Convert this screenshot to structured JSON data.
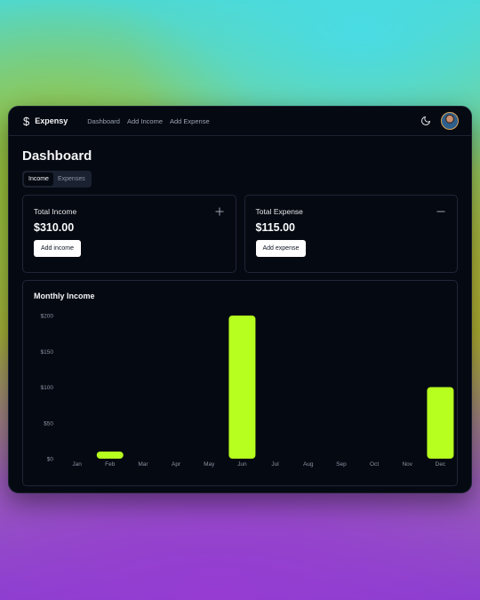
{
  "app": {
    "name": "Expensy",
    "logo_icon": "dollar-icon"
  },
  "nav": {
    "links": [
      "Dashboard",
      "Add Income",
      "Add Expense"
    ],
    "theme_icon": "moon-icon",
    "avatar_icon": "user-avatar"
  },
  "page": {
    "title": "Dashboard",
    "tabs": [
      {
        "label": "Income",
        "active": true
      },
      {
        "label": "Expenses",
        "active": false
      }
    ]
  },
  "cards": {
    "income": {
      "title": "Total Income",
      "value": "$310.00",
      "button": "Add income",
      "icon": "plus-icon"
    },
    "expense": {
      "title": "Total Expense",
      "value": "$115.00",
      "button": "Add expense",
      "icon": "minus-icon"
    }
  },
  "colors": {
    "accent": "#b6ff1f",
    "background": "#050911",
    "border": "#1f2636"
  },
  "chart_data": {
    "type": "bar",
    "title": "Monthly Income",
    "categories": [
      "Jan",
      "Feb",
      "Mar",
      "Apr",
      "May",
      "Jun",
      "Jul",
      "Aug",
      "Sep",
      "Oct",
      "Nov",
      "Dec"
    ],
    "values": [
      0,
      10,
      0,
      0,
      0,
      200,
      0,
      0,
      0,
      0,
      0,
      100
    ],
    "y_tick_labels": [
      "$0",
      "$50",
      "$100",
      "$150",
      "$200"
    ],
    "y_ticks": [
      0,
      50,
      100,
      150,
      200
    ],
    "ylim": [
      0,
      200
    ],
    "grid": false,
    "bar_color": "#b6ff1f"
  }
}
